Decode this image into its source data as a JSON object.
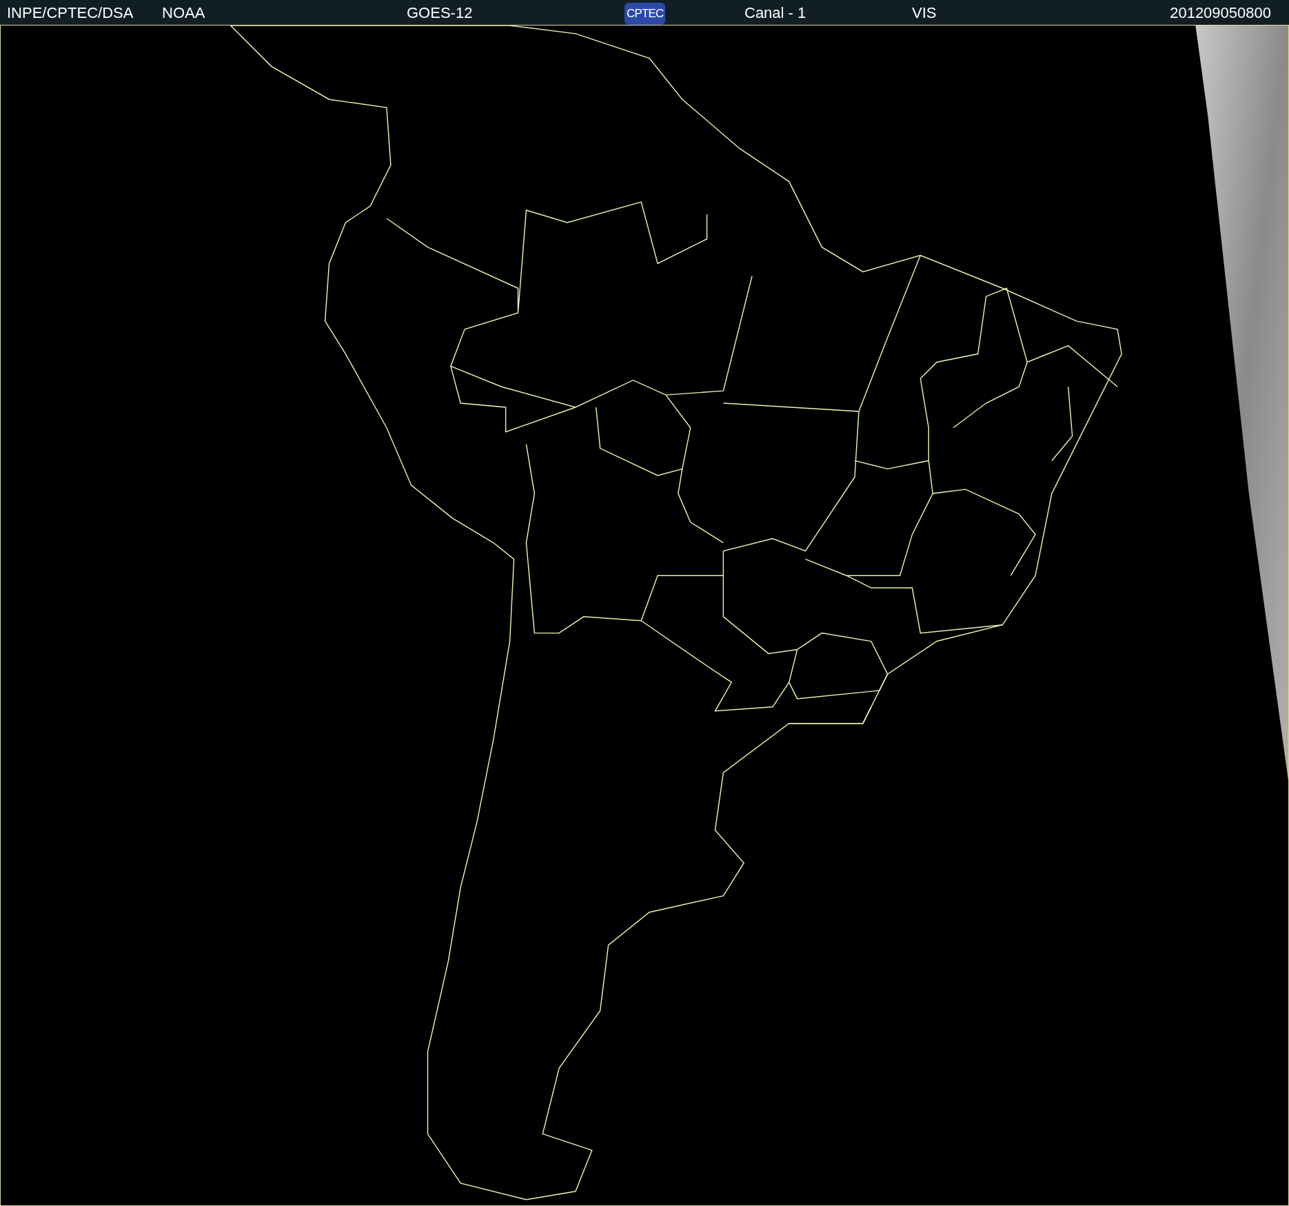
{
  "header": {
    "items": [
      {
        "kind": "text",
        "text": "INPE/CPTEC/DSA"
      },
      {
        "kind": "text",
        "text": "NOAA"
      },
      {
        "kind": "text",
        "text": "GOES-12"
      },
      {
        "kind": "logo",
        "text": "CPTEC"
      },
      {
        "kind": "text",
        "text": "Canal - 1"
      },
      {
        "kind": "text",
        "text": "VIS"
      },
      {
        "kind": "text",
        "text": "201209050800"
      }
    ]
  }
}
